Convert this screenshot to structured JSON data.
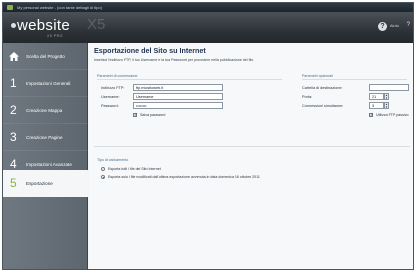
{
  "window": {
    "title": "My personal website - (con tante dettagli di tipo)"
  },
  "header": {
    "logo": "website",
    "logo_sub": "X5 PRO",
    "logo_ghost": "X5",
    "help_icon": "help-icon",
    "right_label": "Aiuto",
    "edge": "?"
  },
  "sidebar": {
    "items": [
      {
        "num": "",
        "icon": "home-icon",
        "label": "Scelta del Progetto"
      },
      {
        "num": "1",
        "icon": "",
        "label": "Impostazioni Generali"
      },
      {
        "num": "2",
        "icon": "",
        "label": "Creazione Mappa"
      },
      {
        "num": "3",
        "icon": "",
        "label": "Creazione Pagine"
      },
      {
        "num": "4",
        "icon": "",
        "label": "Impostazioni Avanzate"
      },
      {
        "num": "5",
        "icon": "",
        "label": "Esportazione"
      }
    ],
    "active_index": 5
  },
  "main": {
    "title": "Esportazione del Sito su Internet",
    "description": "Inserisci l'indirizzo FTP, il tuo Username e la tua Password per procedere nella pubblicazione dei file.",
    "connection": {
      "group_title": "Parametri di connessione",
      "ftp_label": "Indirizzo FTP:",
      "ftp_value": "ftp.miositoweb.it",
      "user_label": "Username:",
      "user_value": "Username",
      "pass_label": "Password:",
      "pass_value": "••••••••",
      "save_password_label": "Salva password"
    },
    "optional": {
      "group_title": "Parametri opzionali",
      "dest_label": "Cartella di destinazione:",
      "dest_value": "",
      "port_label": "Porta:",
      "port_value": "21",
      "conn_label": "Connessioni simultanee:",
      "conn_value": "3",
      "passive_label": "Utilizza FTP passivo"
    },
    "export_type": {
      "group_title": "Tipo di caricamento",
      "option1": "Esporta tutti i file del Sito Internet",
      "option2": "Esporta solo i file modificati dall'ultima esportazione avvenuta in data domenica 16 ottobre 2011"
    }
  }
}
